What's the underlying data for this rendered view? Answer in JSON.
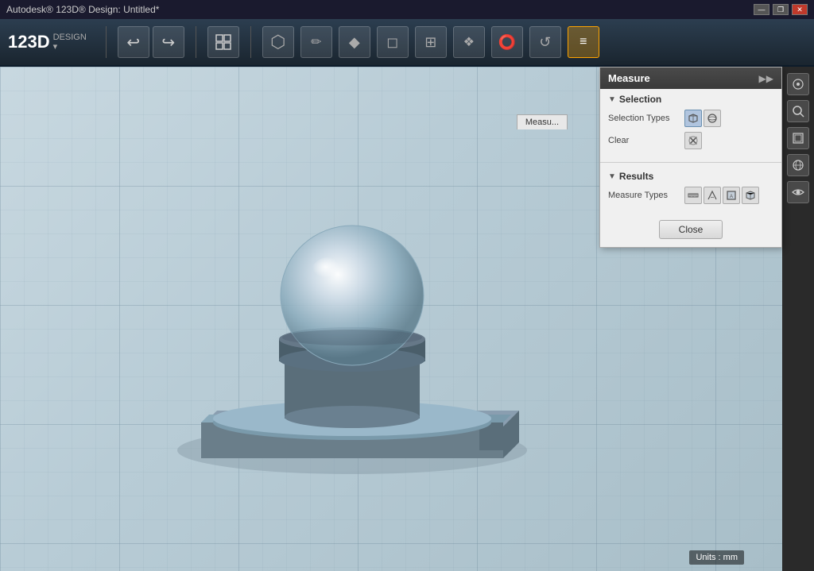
{
  "titleBar": {
    "appName": "Autodesk® 123D® Design: Untitled*",
    "winControls": [
      "—",
      "❐",
      "✕"
    ]
  },
  "toolbar": {
    "logo": "123D",
    "logoSub": "DESIGN",
    "logoArrow": "▾",
    "undoLabel": "↩",
    "redoLabel": "↪",
    "tools": [
      "⊕",
      "✏",
      "◆",
      "◻",
      "⊞",
      "❖",
      "⭕",
      "↺",
      "≡"
    ]
  },
  "measurePanel": {
    "title": "Measure",
    "expandIcon": "▶▶",
    "sections": {
      "selection": {
        "label": "Selection",
        "collapseIcon": "▼",
        "selectionTypes": {
          "label": "Selection Types",
          "buttons": [
            "face",
            "edge"
          ]
        },
        "clear": {
          "label": "Clear",
          "icon": "↩"
        }
      },
      "results": {
        "label": "Results",
        "collapseIcon": "▼",
        "measureTypes": {
          "label": "Measure Types",
          "buttons": [
            "ruler",
            "angle",
            "area",
            "volume"
          ]
        }
      }
    },
    "closeButton": "Close"
  },
  "measureTab": "Measu...",
  "viewport": {
    "unitsLabel": "Units : mm"
  },
  "rightTools": {
    "buttons": [
      "⊕",
      "🔍",
      "⬜",
      "👁",
      "👁"
    ]
  }
}
